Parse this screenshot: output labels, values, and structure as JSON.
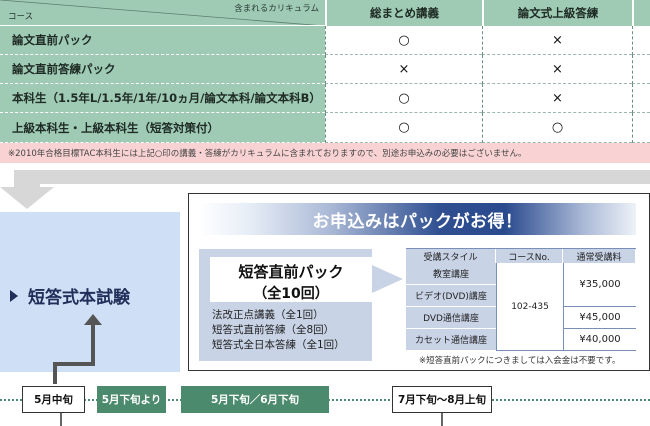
{
  "curriculum_table": {
    "header": {
      "corner_top": "含まれるカリキュラム",
      "corner_bottom": "コース",
      "columns": [
        "総まとめ講義",
        "論文式上級答練"
      ]
    },
    "rows": [
      {
        "course": "論文直前パック",
        "values": [
          "○",
          "×"
        ]
      },
      {
        "course": "論文直前答練パック",
        "values": [
          "×",
          "×"
        ]
      },
      {
        "course": "本科生（1.5年L/1.5年/1年/10ヵ月/論文本科/論文本科B）",
        "values": [
          "○",
          "×"
        ]
      },
      {
        "course": "上級本科生・上級本科生（短答対策付）",
        "values": [
          "○",
          "○"
        ]
      }
    ],
    "note": "※2010年合格目標TAC本科生には上記○印の講義・答練がカリキュラムに含まれておりますので、別途お申込みの必要はございません。"
  },
  "exam": {
    "title": "短答式本試験"
  },
  "promo": {
    "banner": "お申込みはパックがお得！",
    "pack_title": "短答直前パック",
    "pack_count": "（全10回）",
    "pack_items": [
      "法改正点講義（全1回）",
      "短答式直前答練（全8回）",
      "短答式全日本答練（全1回）"
    ],
    "table_headers": [
      "受講スタイル",
      "コースNo.",
      "通常受講料"
    ],
    "styles": [
      "教室講座",
      "ビデオ(DVD)講座",
      "DVD通信講座",
      "カセット通信講座"
    ],
    "course_no": "102-435",
    "prices": [
      "¥35,000",
      "¥45,000",
      "¥40,000"
    ],
    "note": "※短答直前パックにつきましては入会金は不要です。"
  },
  "timeline": [
    "5月中旬",
    "5月下旬より",
    "5月下旬／6月下旬",
    "7月下旬～8月上旬"
  ],
  "colors": {
    "green_header": "#9fcbb5",
    "green_dark": "#4c8a6d",
    "pink_note": "#f9d3d3",
    "blue_panel": "#cfdff5",
    "blue_banner": "#2f4f91",
    "blue_light": "#c8d3e6"
  },
  "icons": [
    "triangle-right-icon",
    "arrow-up-icon",
    "arrow-down-icon"
  ]
}
